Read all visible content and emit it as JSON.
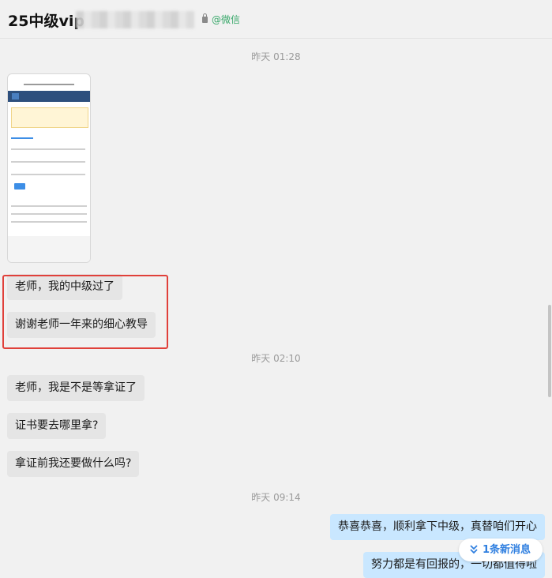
{
  "header": {
    "title": "25中级vip",
    "tag": "@微信"
  },
  "messages": {
    "time1": "昨天 01:28",
    "msg1": "老师，我的中级过了",
    "msg2": "谢谢老师一年来的细心教导",
    "time2": "昨天 02:10",
    "msg3": "老师，我是不是等拿证了",
    "msg4": "证书要去哪里拿?",
    "msg5": "拿证前我还要做什么吗?",
    "time3": "昨天 09:14",
    "reply1": "恭喜恭喜，顺利拿下中级，真替咱们开心",
    "reply2": "努力都是有回报的，一切都值得啦"
  },
  "new_messages": {
    "label": "1条新消息"
  },
  "colors": {
    "incoming": "#e5e5e5",
    "outgoing": "#c9e7ff",
    "highlight": "#e0403a",
    "accent": "#2f7fe0",
    "wechat": "#39a86a"
  }
}
